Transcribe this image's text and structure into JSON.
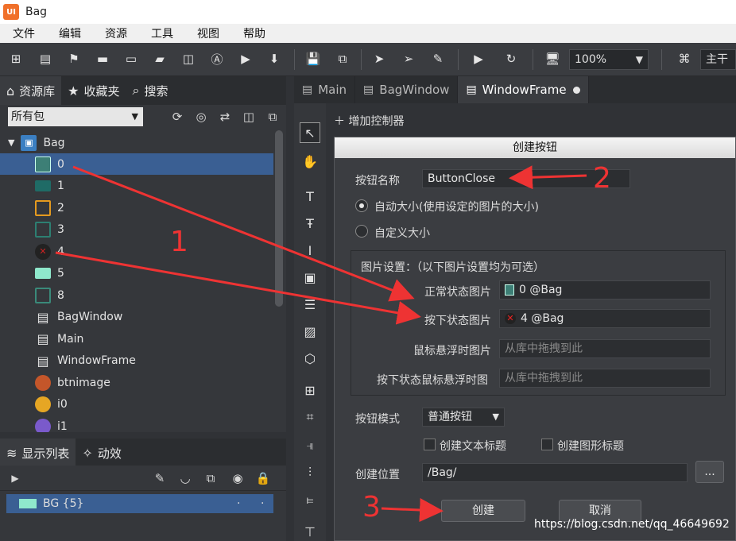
{
  "app": {
    "logo": "UI",
    "title": "Bag"
  },
  "menu": [
    "文件",
    "编辑",
    "资源",
    "工具",
    "视图",
    "帮助"
  ],
  "toolbar": {
    "zoom": "100%",
    "branch": "主干"
  },
  "left_tabs": [
    {
      "label": "资源库",
      "icon": "home-icon"
    },
    {
      "label": "收藏夹",
      "icon": "star-icon"
    },
    {
      "label": "搜索",
      "icon": "search-icon"
    }
  ],
  "package_filter": "所有包",
  "tree": {
    "root": "Bag",
    "items": [
      {
        "label": "0",
        "thumb": "btn-thumb",
        "color": "#3d7f76"
      },
      {
        "label": "1",
        "thumb": "fill",
        "color": "#1f6b66"
      },
      {
        "label": "2",
        "thumb": "outline",
        "color": "#e59a1f"
      },
      {
        "label": "3",
        "thumb": "outline",
        "color": "#2d7f72"
      },
      {
        "label": "4",
        "thumb": "close",
        "color": "#cc2222"
      },
      {
        "label": "5",
        "thumb": "fill",
        "color": "#8fe8cc"
      },
      {
        "label": "8",
        "thumb": "outline",
        "color": "#3a8a7a"
      },
      {
        "label": "BagWindow",
        "thumb": "doc"
      },
      {
        "label": "Main",
        "thumb": "doc"
      },
      {
        "label": "WindowFrame",
        "thumb": "doc"
      },
      {
        "label": "btnimage",
        "thumb": "img",
        "color": "#c4562a"
      },
      {
        "label": "i0",
        "thumb": "img",
        "color": "#e6a624"
      },
      {
        "label": "i1",
        "thumb": "img",
        "color": "#7a5acb"
      }
    ]
  },
  "display_tabs": [
    {
      "label": "显示列表",
      "icon": "layers-icon"
    },
    {
      "label": "动效",
      "icon": "effect-icon"
    }
  ],
  "display_list": {
    "row": "BG {5}",
    "row_color": "#8fe8cc"
  },
  "doc_tabs": [
    {
      "label": "Main"
    },
    {
      "label": "BagWindow"
    },
    {
      "label": "WindowFrame"
    }
  ],
  "add_controller": "增加控制器",
  "dialog": {
    "title": "创建按钮",
    "name_label": "按钮名称",
    "name_value": "ButtonClose",
    "auto_size": "自动大小(使用设定的图片的大小)",
    "custom_size": "自定义大小",
    "image_group_label": "图片设置：（以下图片设置均为可选）",
    "normal_label": "正常状态图片",
    "normal_value": "0 @Bag",
    "down_label": "按下状态图片",
    "down_value": "4 @Bag",
    "hover_label": "鼠标悬浮时图片",
    "hover_placeholder": "从库中拖拽到此",
    "down_hover_label": "按下状态鼠标悬浮时图",
    "down_hover_placeholder": "从库中拖拽到此",
    "mode_label": "按钮模式",
    "mode_value": "普通按钮",
    "create_text_title": "创建文本标题",
    "create_image_title": "创建图形标题",
    "location_label": "创建位置",
    "location_value": "/Bag/",
    "browse": "...",
    "create_button": "创建",
    "cancel_button": "取消"
  },
  "annotations": {
    "one": "1",
    "two": "2",
    "three": "3",
    "color": "#ee3333"
  },
  "watermark": "https://blog.csdn.net/qq_46649692"
}
